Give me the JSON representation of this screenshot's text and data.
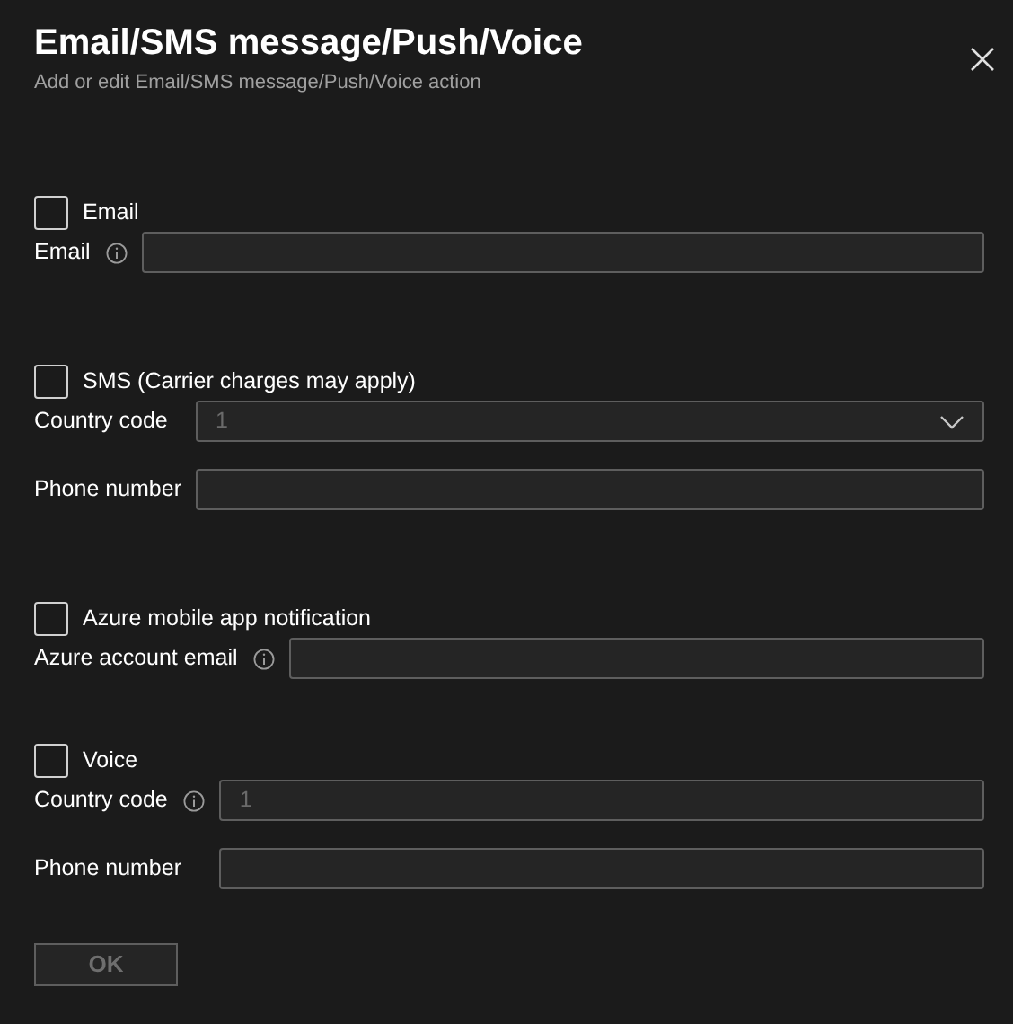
{
  "title": "Email/SMS message/Push/Voice",
  "subtitle": "Add or edit Email/SMS message/Push/Voice action",
  "sections": [
    {
      "checkbox": {
        "label": "Email",
        "checked": false
      },
      "fields": [
        {
          "kind": "text",
          "label": "Email",
          "info": true,
          "disabled": false
        }
      ]
    },
    {
      "checkbox": {
        "label": "SMS (Carrier charges may apply)",
        "checked": false
      },
      "fields": [
        {
          "kind": "select",
          "label": "Country code",
          "info": false,
          "value": "1",
          "disabled": true
        },
        {
          "kind": "text",
          "label": "Phone number",
          "info": false,
          "disabled": false
        }
      ]
    },
    {
      "checkbox": {
        "label": "Azure mobile app notification",
        "checked": false
      },
      "fields": [
        {
          "kind": "text",
          "label": "Azure account email",
          "info": true,
          "disabled": false
        }
      ]
    },
    {
      "checkbox": {
        "label": "Voice",
        "checked": false
      },
      "fields": [
        {
          "kind": "text",
          "label": "Country code",
          "info": true,
          "value": "1",
          "disabled": true
        },
        {
          "kind": "text",
          "label": "Phone number",
          "info": false,
          "disabled": false
        }
      ]
    }
  ],
  "ok_button": {
    "label": "OK",
    "disabled": true
  }
}
